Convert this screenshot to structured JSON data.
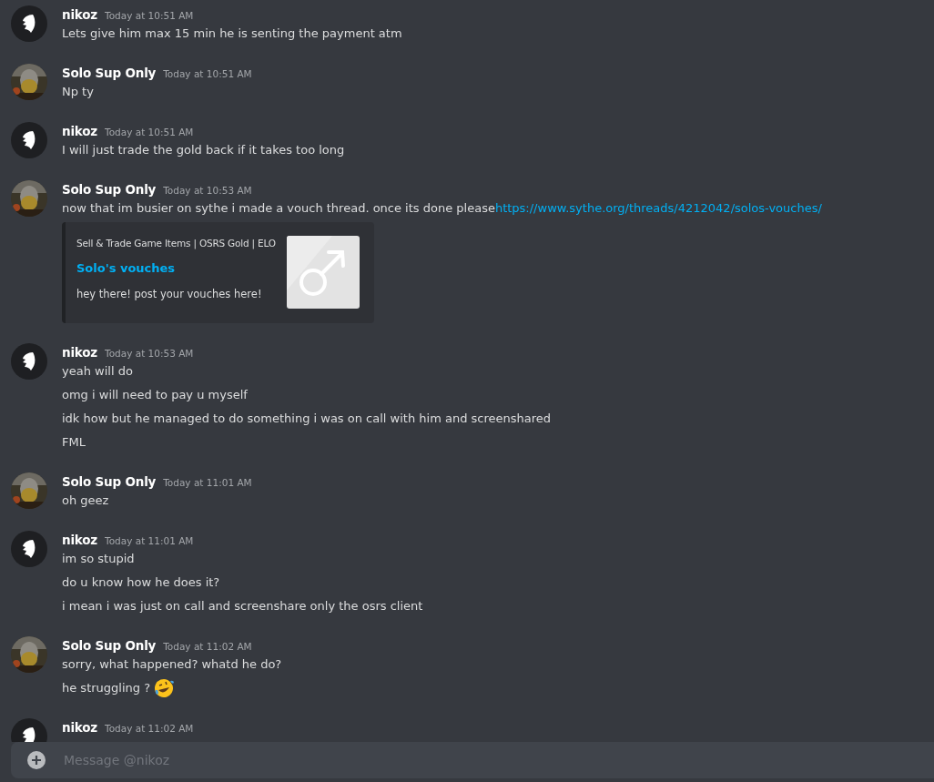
{
  "messages": [
    {
      "author": "nikoz",
      "kind": "helmet",
      "time": "Today at 10:51 AM",
      "lines": [
        {
          "text": "Lets give him max 15 min he is senting the payment atm"
        }
      ]
    },
    {
      "author": "Solo Sup Only",
      "time": "Today at 10:51 AM",
      "lines": [
        {
          "text": "Np ty"
        }
      ]
    },
    {
      "author": "nikoz",
      "kind": "helmet",
      "time": "Today at 10:51 AM",
      "lines": [
        {
          "text": "I will just trade the gold back if it takes too long"
        }
      ]
    },
    {
      "author": "Solo Sup Only",
      "time": "Today at 10:53 AM",
      "lines": [
        {
          "text": "now that im busier on sythe i made a vouch thread. once its done please",
          "link": "https://www.sythe.org/threads/4212042/solos-vouches/"
        }
      ],
      "embed": {
        "provider": "Sell & Trade Game Items | OSRS Gold | ELO",
        "title": "Solo's vouches",
        "description": "hey there! post your vouches here!"
      }
    },
    {
      "author": "nikoz",
      "kind": "helmet",
      "time": "Today at 10:53 AM",
      "lines": [
        {
          "text": "yeah will do"
        },
        {
          "text": "omg i will need to pay u myself"
        },
        {
          "text": "idk how but he managed to do something i was on call with him and screenshared"
        },
        {
          "text": "FML"
        }
      ]
    },
    {
      "author": "Solo Sup Only",
      "time": "Today at 11:01 AM",
      "lines": [
        {
          "text": "oh geez"
        }
      ]
    },
    {
      "author": "nikoz",
      "kind": "helmet",
      "time": "Today at 11:01 AM",
      "lines": [
        {
          "text": "im so stupid"
        },
        {
          "text": "do u know how he does it?"
        },
        {
          "text": "i mean i was just on call and screenshare only the osrs client"
        }
      ]
    },
    {
      "author": "Solo Sup Only",
      "time": "Today at 11:02 AM",
      "lines": [
        {
          "text": "sorry, what happened? whatd he do?"
        },
        {
          "text": "he struggling ?",
          "emoji": true
        }
      ]
    },
    {
      "author": "nikoz",
      "kind": "helmet",
      "time": "Today at 11:02 AM"
    }
  ],
  "composer": {
    "placeholder": "Message @nikoz"
  }
}
